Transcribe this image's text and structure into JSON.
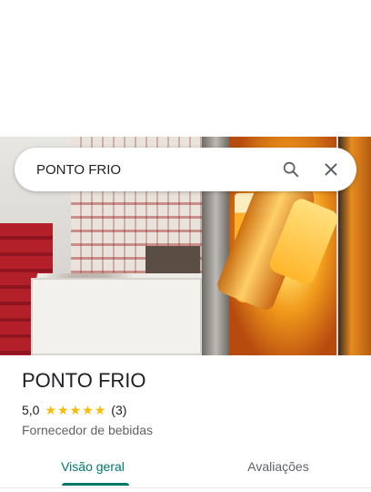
{
  "search": {
    "query": "PONTO FRIO",
    "search_icon": "search-icon",
    "close_icon": "close-icon"
  },
  "place": {
    "name": "PONTO FRIO",
    "rating": "5,0",
    "stars": 5,
    "review_count": "(3)",
    "category": "Fornecedor de bebidas"
  },
  "tabs": [
    {
      "label": "Visão geral",
      "active": true
    },
    {
      "label": "Avaliações",
      "active": false
    }
  ],
  "colors": {
    "accent": "#00796b",
    "star": "#fbbc04",
    "text": "#202124",
    "secondary_text": "#5f6368"
  }
}
